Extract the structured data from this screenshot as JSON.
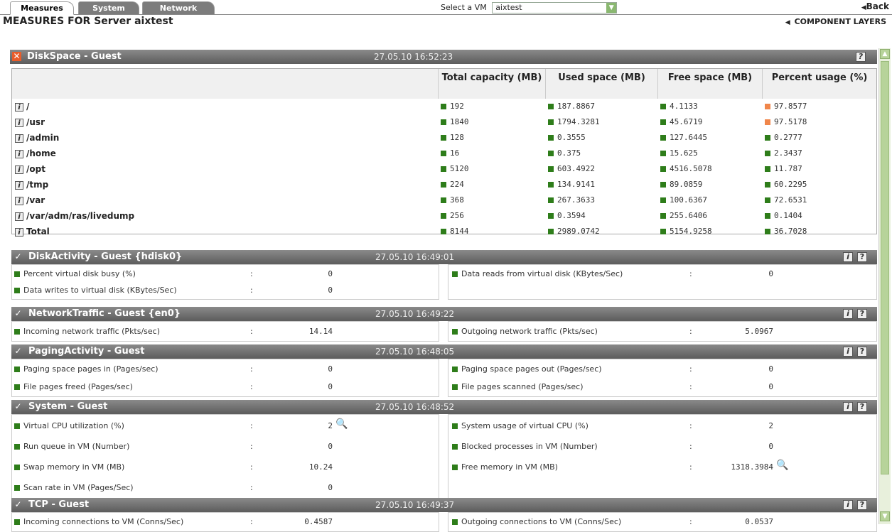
{
  "tabs": [
    {
      "label": "Measures",
      "active": true
    },
    {
      "label": "System",
      "active": false
    },
    {
      "label": "Network",
      "active": false
    }
  ],
  "vm_select": {
    "label": "Select a VM",
    "value": "aixtest"
  },
  "back_label": "Back",
  "page_title": "MEASURES FOR Server aixtest",
  "component_layers": "COMPONENT LAYERS",
  "colors": {
    "good": "#2e7d1a",
    "warn": "#f0864a",
    "header": "#6e6e6e"
  },
  "disk": {
    "title": "DiskSpace - Guest",
    "timestamp": "27.05.10 16:52:23",
    "columns": [
      "Total capacity (MB)",
      "Used space (MB)",
      "Free space (MB)",
      "Percent usage (%)"
    ],
    "rows": [
      {
        "name": "/",
        "total": "192",
        "used": "187.8867",
        "free": "4.1133",
        "pct": "97.8577",
        "pct_status": "warn"
      },
      {
        "name": "/usr",
        "total": "1840",
        "used": "1794.3281",
        "free": "45.6719",
        "pct": "97.5178",
        "pct_status": "warn"
      },
      {
        "name": "/admin",
        "total": "128",
        "used": "0.3555",
        "free": "127.6445",
        "pct": "0.2777",
        "pct_status": "good"
      },
      {
        "name": "/home",
        "total": "16",
        "used": "0.375",
        "free": "15.625",
        "pct": "2.3437",
        "pct_status": "good"
      },
      {
        "name": "/opt",
        "total": "5120",
        "used": "603.4922",
        "free": "4516.5078",
        "pct": "11.787",
        "pct_status": "good"
      },
      {
        "name": "/tmp",
        "total": "224",
        "used": "134.9141",
        "free": "89.0859",
        "pct": "60.2295",
        "pct_status": "good"
      },
      {
        "name": "/var",
        "total": "368",
        "used": "267.3633",
        "free": "100.6367",
        "pct": "72.6531",
        "pct_status": "good"
      },
      {
        "name": "/var/adm/ras/livedump",
        "total": "256",
        "used": "0.3594",
        "free": "255.6406",
        "pct": "0.1404",
        "pct_status": "good"
      },
      {
        "name": "Total",
        "total": "8144",
        "used": "2989.0742",
        "free": "5154.9258",
        "pct": "36.7028",
        "pct_status": "good"
      }
    ]
  },
  "sections": [
    {
      "title": "DiskActivity - Guest {hdisk0}",
      "timestamp": "27.05.10 16:49:01",
      "left": [
        {
          "label": "Percent virtual disk busy (%)",
          "value": "0"
        },
        {
          "label": "Data writes to virtual disk (KBytes/Sec)",
          "value": "0"
        }
      ],
      "right": [
        {
          "label": "Data reads from virtual disk (KBytes/Sec)",
          "value": "0"
        }
      ]
    },
    {
      "title": "NetworkTraffic - Guest {en0}",
      "timestamp": "27.05.10 16:49:22",
      "left": [
        {
          "label": "Incoming network traffic (Pkts/sec)",
          "value": "14.14"
        }
      ],
      "right": [
        {
          "label": "Outgoing network traffic (Pkts/sec)",
          "value": "5.0967"
        }
      ]
    },
    {
      "title": "PagingActivity - Guest",
      "timestamp": "27.05.10 16:48:05",
      "left": [
        {
          "label": "Paging space pages in (Pages/sec)",
          "value": "0"
        },
        {
          "label": "File pages freed (Pages/sec)",
          "value": "0"
        }
      ],
      "right": [
        {
          "label": "Paging space pages out (Pages/sec)",
          "value": "0"
        },
        {
          "label": "File pages scanned (Pages/sec)",
          "value": "0"
        }
      ]
    },
    {
      "title": "System - Guest",
      "timestamp": "27.05.10 16:48:52",
      "left": [
        {
          "label": "Virtual CPU utilization (%)",
          "value": "2"
        },
        {
          "label": "Run queue in VM (Number)",
          "value": "0"
        },
        {
          "label": "Swap memory in VM (MB)",
          "value": "10.24"
        },
        {
          "label": "Scan rate in VM (Pages/Sec)",
          "value": "0"
        }
      ],
      "right": [
        {
          "label": "System usage of virtual CPU (%)",
          "value": "2"
        },
        {
          "label": "Blocked processes in VM (Number)",
          "value": "0"
        },
        {
          "label": "Free memory in VM (MB)",
          "value": "1318.3984"
        }
      ]
    },
    {
      "title": "TCP - Guest",
      "timestamp": "27.05.10 16:49:37",
      "left": [
        {
          "label": "Incoming connections to VM (Conns/Sec)",
          "value": "0.4587"
        }
      ],
      "right": [
        {
          "label": "Outgoing connections to VM (Conns/Sec)",
          "value": "0.0537"
        }
      ]
    }
  ],
  "colon": ":"
}
